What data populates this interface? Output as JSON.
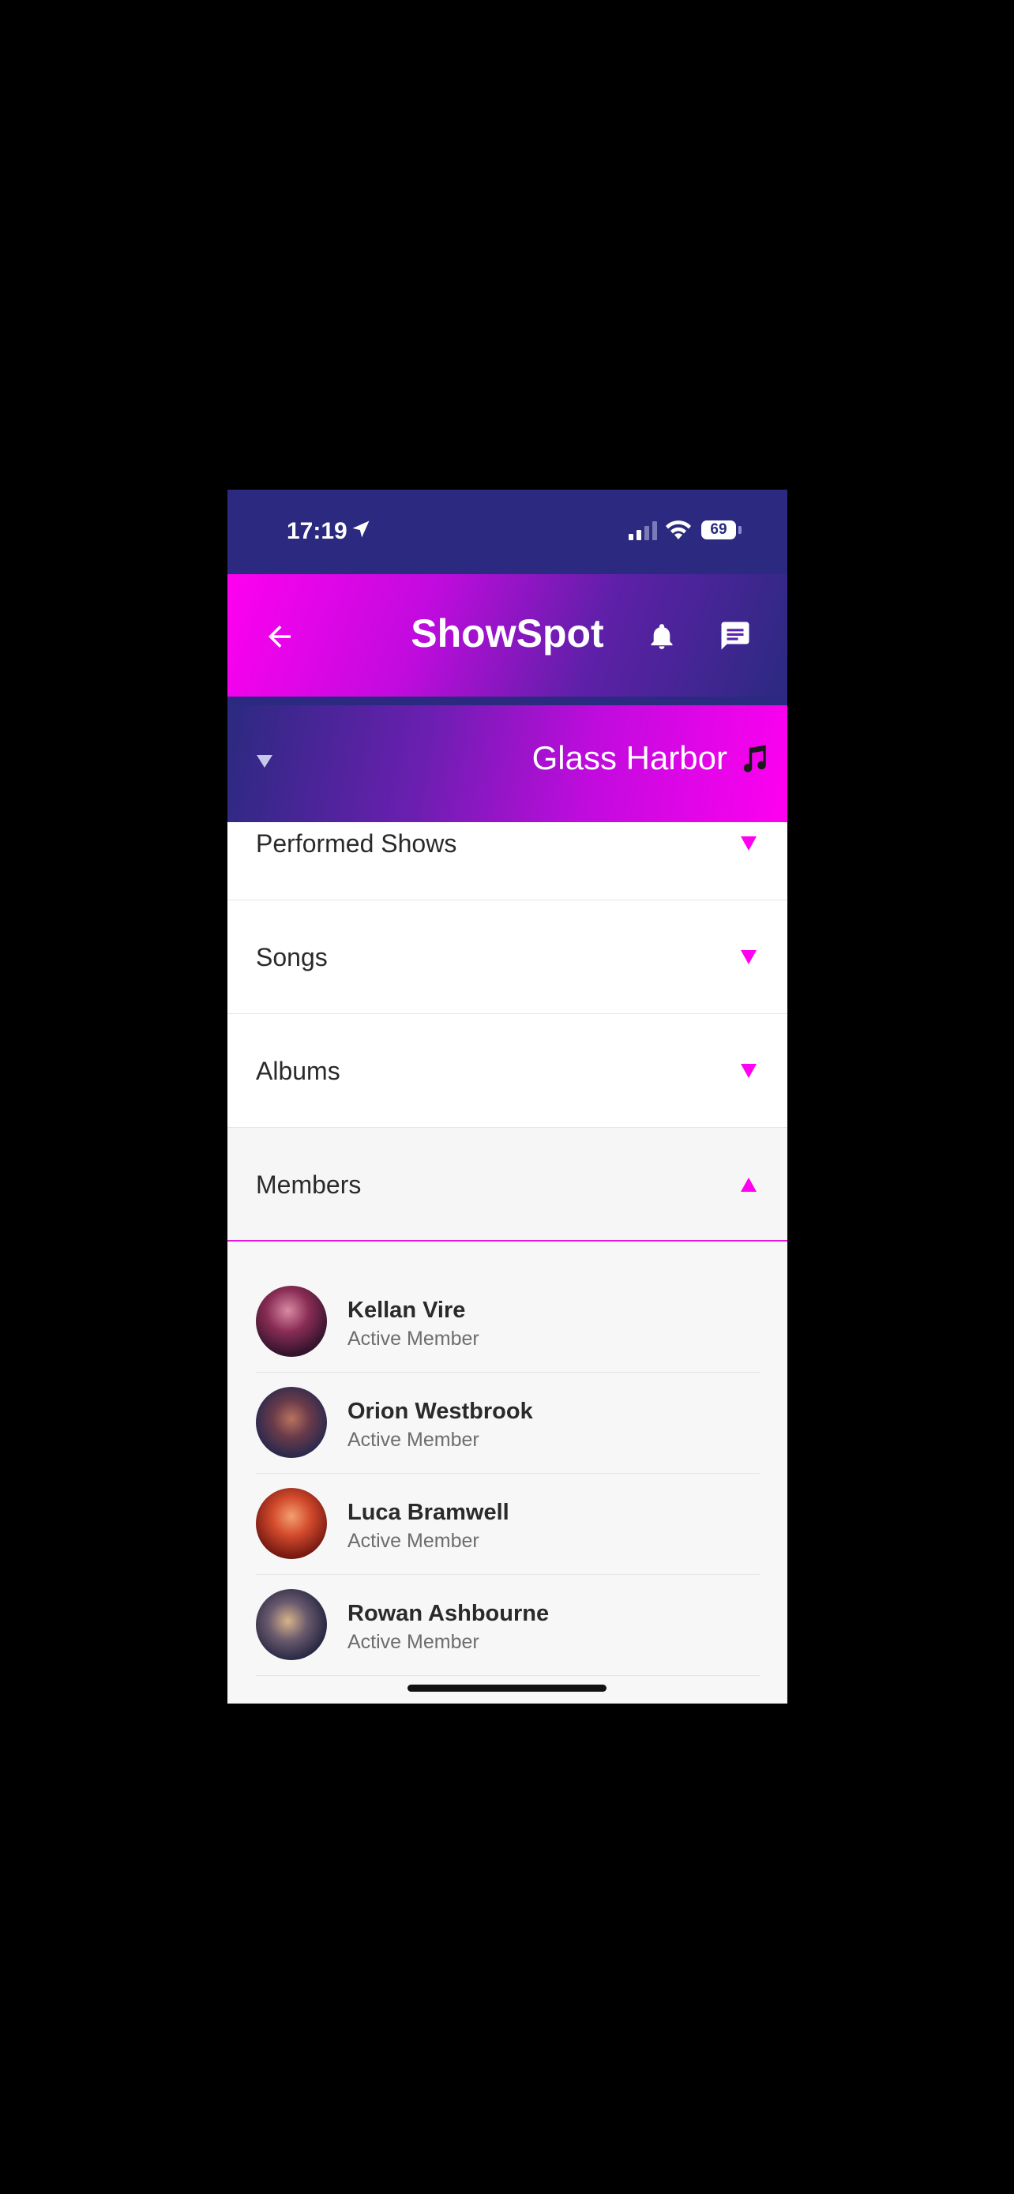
{
  "status_bar": {
    "time": "17:19",
    "battery": "69"
  },
  "header": {
    "title": "ShowSpot"
  },
  "band": {
    "name": "Glass Harbor"
  },
  "sections": [
    {
      "label": "Performed Shows",
      "expanded": false
    },
    {
      "label": "Songs",
      "expanded": false
    },
    {
      "label": "Albums",
      "expanded": false
    },
    {
      "label": "Members",
      "expanded": true
    }
  ],
  "members": [
    {
      "name": "Kellan Vire",
      "role": "Active Member"
    },
    {
      "name": "Orion Westbrook",
      "role": "Active Member"
    },
    {
      "name": "Luca Bramwell",
      "role": "Active Member"
    },
    {
      "name": "Rowan Ashbourne",
      "role": "Active Member"
    }
  ],
  "colors": {
    "accent": "#ff00f0",
    "navy": "#2b2a80"
  }
}
